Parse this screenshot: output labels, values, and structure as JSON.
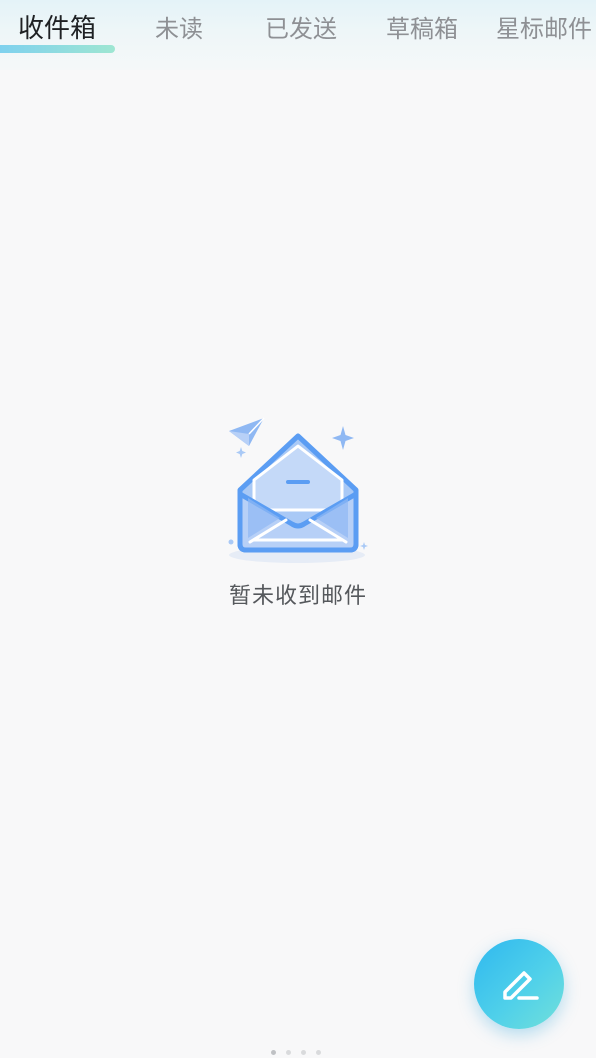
{
  "tabs": [
    {
      "label": "收件箱",
      "active": true
    },
    {
      "label": "未读",
      "active": false
    },
    {
      "label": "已发送",
      "active": false
    },
    {
      "label": "草稿箱",
      "active": false
    },
    {
      "label": "星标邮件",
      "active": false
    }
  ],
  "empty_state": {
    "illustration": "open-envelope-icon",
    "message": "暂未收到邮件"
  },
  "compose_button": {
    "icon": "pencil-compose-icon"
  },
  "pager": {
    "count": 4,
    "active_index": 0
  },
  "colors": {
    "accent_gradient_start": "#2fb8ef",
    "accent_gradient_end": "#72e0da",
    "envelope_blue": "#5b9df3",
    "envelope_fill": "#a9c9f6",
    "active_tab_text": "#1f2124",
    "inactive_tab_text": "#8e9094"
  }
}
